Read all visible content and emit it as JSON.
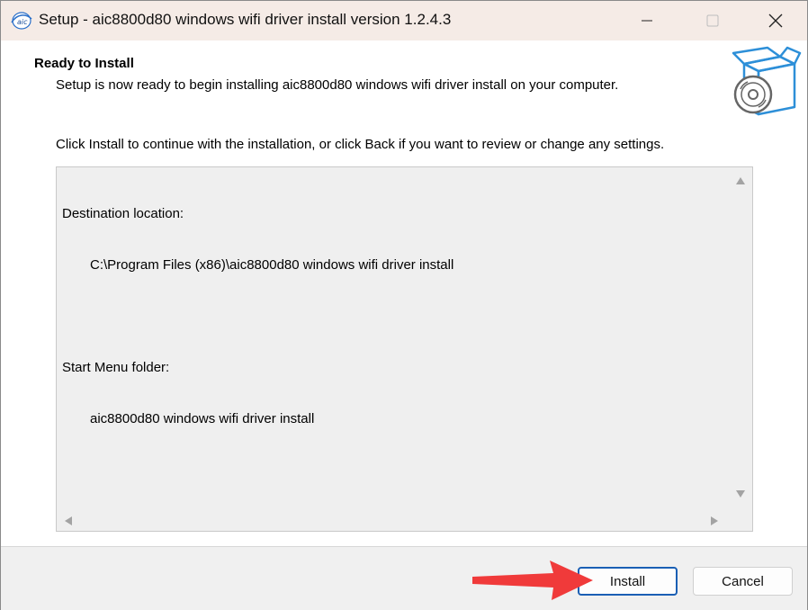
{
  "window": {
    "title": "Setup - aic8800d80 windows wifi driver install version 1.2.4.3"
  },
  "title_bar_buttons": {
    "minimize_icon": "minimize-icon",
    "maximize_icon": "maximize-icon",
    "close_icon": "close-icon"
  },
  "header": {
    "heading": "Ready to Install",
    "subheading": "Setup is now ready to begin installing aic8800d80 windows wifi driver install on your computer."
  },
  "content": {
    "instruction": "Click Install to continue with the installation, or click Back if you want to review or change any settings.",
    "memo": {
      "destination_label": "Destination location:",
      "destination_value": "C:\\Program Files (x86)\\aic8800d80 windows wifi driver install",
      "start_menu_label": "Start Menu folder:",
      "start_menu_value": "aic8800d80 windows wifi driver install"
    }
  },
  "footer": {
    "install_label": "Install",
    "cancel_label": "Cancel"
  },
  "colors": {
    "title_bar": "#f5ebe6",
    "accent": "#1a5fb4",
    "annotation_arrow": "#f03a3a",
    "setup_icon_blue": "#2d8fd8"
  }
}
